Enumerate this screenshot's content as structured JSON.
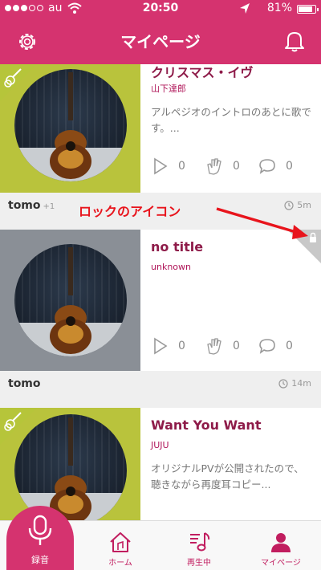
{
  "status_bar": {
    "carrier": "au",
    "time": "20:50",
    "battery": "81%"
  },
  "header": {
    "title": "マイページ"
  },
  "annotation": {
    "text": "ロックのアイコン"
  },
  "feed": [
    {
      "title": "クリスマス・イヴ",
      "artist": "山下達郎",
      "description": "アルペジオのイントロのあとに歌です。...",
      "plays": "0",
      "claps": "0",
      "comments": "0"
    },
    {
      "user": "tomo",
      "user_count": "+1",
      "ago": "5m",
      "title": "no title",
      "artist": "unknown",
      "plays": "0",
      "claps": "0",
      "comments": "0"
    },
    {
      "user": "tomo",
      "ago": "14m",
      "title": "Want You Want",
      "artist": "JUJU",
      "description": "オリジナルPVが公開されたので、聴きながら再度耳コピー..."
    }
  ],
  "tabbar": {
    "record": "録音",
    "home": "ホーム",
    "playing": "再生中",
    "mypage": "マイページ"
  },
  "colors": {
    "accent": "#d5336f",
    "title": "#8e1b49"
  }
}
